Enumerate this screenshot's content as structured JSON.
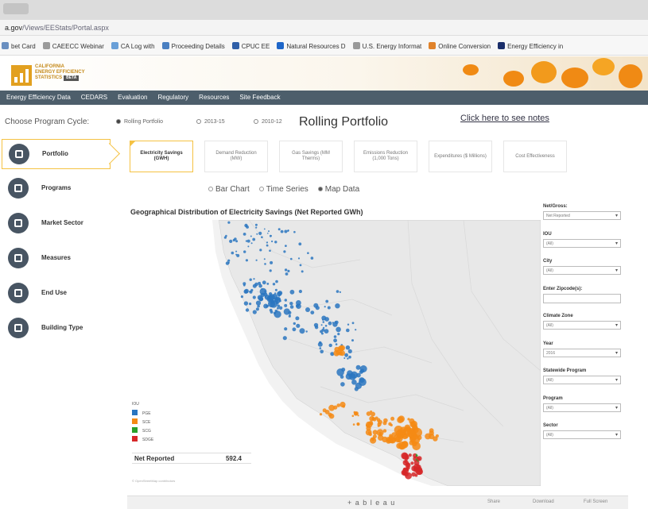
{
  "browser": {
    "url_host": "a.gov",
    "url_path": "/Views/EEStats/Portal.aspx",
    "bookmarks": [
      {
        "label": "bet Card",
        "color": "#6a8fc0"
      },
      {
        "label": "CAEECC Webinar",
        "color": "#9a9a9a"
      },
      {
        "label": "CA Log with",
        "color": "#6aa0d8"
      },
      {
        "label": "Proceeding Details",
        "color": "#4a7fc1"
      },
      {
        "label": "CPUC EE",
        "color": "#2f5fa8"
      },
      {
        "label": "Natural Resources D",
        "color": "#1e66c9"
      },
      {
        "label": "U.S. Energy Informat",
        "color": "#999999"
      },
      {
        "label": "Online Conversion",
        "color": "#e0822a"
      },
      {
        "label": "Energy Efficiency in",
        "color": "#1a2e6a"
      }
    ]
  },
  "logo": {
    "line1": "CALIFORNIA",
    "line2": "ENERGY EFFICIENCY",
    "line3": "STATISTICS",
    "badge": "BETA"
  },
  "nav": [
    "Energy Efficiency Data",
    "CEDARS",
    "Evaluation",
    "Regulatory",
    "Resources",
    "Site Feedback"
  ],
  "cycle": {
    "label": "Choose Program Cycle:",
    "options": [
      "Rolling Portfolio",
      "2013-15",
      "2010-12"
    ],
    "selected": "Rolling Portfolio",
    "heading": "Rolling Portfolio",
    "notes_link": "Click here to see notes"
  },
  "sidebar": [
    {
      "label": "Portfolio",
      "active": true
    },
    {
      "label": "Programs",
      "active": false
    },
    {
      "label": "Market Sector",
      "active": false
    },
    {
      "label": "Measures",
      "active": false
    },
    {
      "label": "End Use",
      "active": false
    },
    {
      "label": "Building Type",
      "active": false
    }
  ],
  "metrics": [
    {
      "label": "Electricity Savings (GWH)",
      "active": true
    },
    {
      "label": "Demand Reduction (MW)",
      "active": false
    },
    {
      "label": "Gas Savings (MM Therms)",
      "active": false
    },
    {
      "label": "Emissions Reduction (1,000 Tons)",
      "active": false
    },
    {
      "label": "Expenditures ($ Millions)",
      "active": false
    },
    {
      "label": "Cost Effectiveness",
      "active": false
    }
  ],
  "view_modes": [
    "Bar Chart",
    "Time Series",
    "Map Data"
  ],
  "view_selected": "Map Data",
  "map": {
    "title": "Geographical Distribution of Electricity Savings (Net Reported GWh)",
    "legend_title": "IOU",
    "legend": [
      {
        "label": "PGE",
        "color": "#2a75c0"
      },
      {
        "label": "SCE",
        "color": "#f58a14"
      },
      {
        "label": "SCG",
        "color": "#2aa02a"
      },
      {
        "label": "SDGE",
        "color": "#d62728"
      }
    ],
    "net_label": "Net Reported",
    "net_value": "592.4",
    "credit": "© OpenStreetMap contributors"
  },
  "filters": [
    {
      "label": "Net/Gross:",
      "value": "Net Reported"
    },
    {
      "label": "IOU",
      "value": "(All)"
    },
    {
      "label": "City",
      "value": "(All)"
    },
    {
      "label": "Enter Zipcode(s):",
      "value": ""
    },
    {
      "label": "Climate Zone",
      "value": "(All)"
    },
    {
      "label": "Year",
      "value": "2016"
    },
    {
      "label": "Statewide Program",
      "value": "(All)"
    },
    {
      "label": "Program",
      "value": "(All)"
    },
    {
      "label": "Sector",
      "value": "(All)"
    }
  ],
  "footer": {
    "logo": "+ a b l e a u",
    "tools": [
      "Share",
      "Download",
      "Full Screen"
    ]
  }
}
